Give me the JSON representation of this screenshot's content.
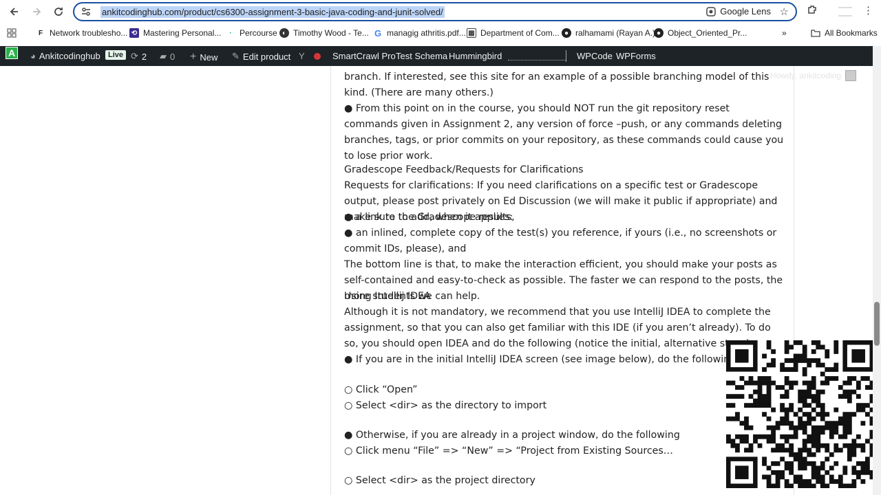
{
  "browser": {
    "url": "ankitcodinghub.com/product/cs6300-assignment-3-basic-java-coding-and-junit-solved/",
    "lens_label": "Google Lens"
  },
  "bookmarks": [
    {
      "label": "Network troublesho...",
      "icon": "bookmark-icon-1"
    },
    {
      "label": "Mastering Personal...",
      "icon": "bookmark-icon-2"
    },
    {
      "label": "Percourse",
      "icon": "bookmark-icon-3"
    },
    {
      "label": "Timothy Wood - Te...",
      "icon": "bookmark-icon-4"
    },
    {
      "label": "managig athritis.pdf...",
      "icon": "google-icon"
    },
    {
      "label": "Department of Com...",
      "icon": "bookmark-icon-6"
    },
    {
      "label": "ralhamami (Rayan A.)",
      "icon": "github-icon"
    },
    {
      "label": "Object_Oriented_Pr...",
      "icon": "github-icon"
    }
  ],
  "all_bookmarks": "All Bookmarks",
  "adminbar": {
    "site": "Ankitcodinghub",
    "live": "Live",
    "updates": "2",
    "comments": "0",
    "new": "New",
    "edit": "Edit product",
    "smartcrawl": "SmartCrawl Pro",
    "schema": "Test Schema",
    "hummingbird": "Hummingbird",
    "wpcode": "WPCode",
    "wpforms": "WPForms"
  },
  "howdy": "Howdy, ankitcoding",
  "content": {
    "p1": "branch. If interested, see this site for an example of a possible branching model of this kind. (There are many others.)",
    "p2": "● From this point on in the course, you should NOT run the git repository reset commands given in Assignment 2, any version of force –push, or any commands deleting branches, tags, or prior commits on your repository, as these commands could cause you to lose prior work.",
    "p3": "Gradescope Feedback/Requests for Clarifications",
    "p4": "Requests for clarifications: If you need clarifications on a specific test or Gradescope output, please post privately on Ed Discussion (we will make it public if appropriate) and make sure to add, when it applies:",
    "p5": "● a link to the Gradescope results,",
    "p6": "● an inlined, complete copy of the test(s) you reference, if yours (i.e., no screenshots or commit IDs, please), and",
    "p7": "The bottom line is that, to make the interaction efficient, you should make your posts as self-contained and easy-to-check as possible. The faster we can respond to the posts, the more students we can help.",
    "p8": "Using Intellij IDEA",
    "p9": "Although it is not mandatory, we recommend that you use IntelliJ IDEA to complete the assignment, so that you can also get familiar with this IDE (if you aren’t already). To do so, you should open IDEA and do the following (notice the initial, alternative steps):",
    "p10": "● If you are in the initial IntelliJ IDEA screen (see image below), do the following:",
    "p11": "○ Click “Open”",
    "p12": "○ Select <dir> as the directory to import",
    "p13": "● Otherwise, if you are already in a project window, do the following",
    "p14": "○ Click menu “File” => “New” => “Project from Existing Sources…",
    "p15": "○ Select <dir> as the project directory"
  }
}
